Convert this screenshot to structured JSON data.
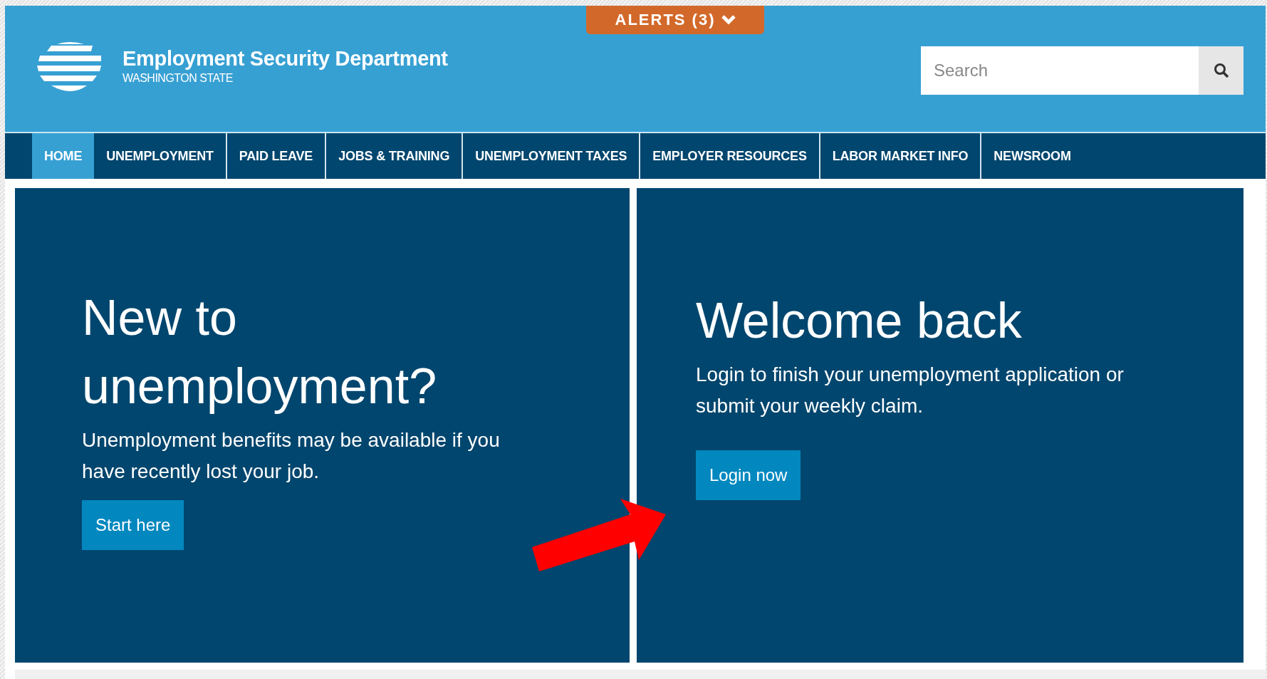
{
  "alerts": {
    "label": "ALERTS (3)"
  },
  "header": {
    "title": "Employment Security Department",
    "subtitle": "WASHINGTON STATE"
  },
  "search": {
    "placeholder": "Search"
  },
  "nav": [
    {
      "label": "HOME",
      "selected": true
    },
    {
      "label": "UNEMPLOYMENT",
      "selected": false
    },
    {
      "label": "PAID LEAVE",
      "selected": false
    },
    {
      "label": "JOBS & TRAINING",
      "selected": false
    },
    {
      "label": "UNEMPLOYMENT TAXES",
      "selected": false
    },
    {
      "label": "EMPLOYER RESOURCES",
      "selected": false
    },
    {
      "label": "LABOR MARKET INFO",
      "selected": false
    },
    {
      "label": "NEWSROOM",
      "selected": false
    }
  ],
  "panels": [
    {
      "heading": "New to unemployment?",
      "text": "Unemployment benefits may be available if you have recently lost your job.",
      "button": "Start here"
    },
    {
      "heading": "Welcome back",
      "text": "Login to finish your unemployment application or submit your weekly claim.",
      "button": "Login now"
    }
  ]
}
